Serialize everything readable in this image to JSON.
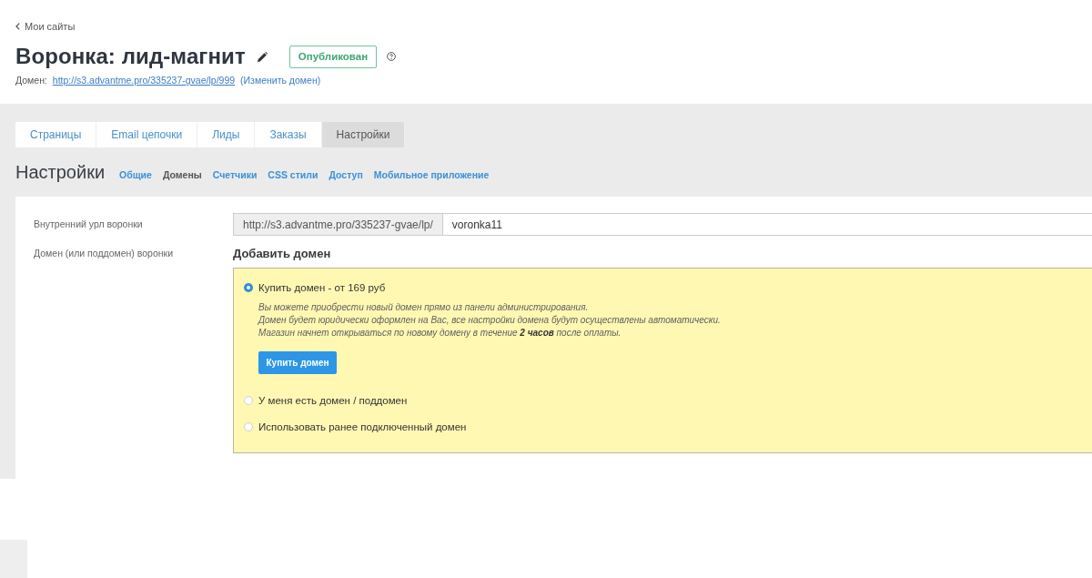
{
  "back_link": {
    "label": "Мои сайты"
  },
  "title": "Воронка: лид-магнит",
  "status_badge": "Опубликован",
  "domain_line": {
    "label": "Домен:",
    "url": "http://s3.advantme.pro/335237-gvae/lp/999",
    "change_link": "(Изменить домен)"
  },
  "tabs": [
    {
      "label": "Страницы",
      "selected": false
    },
    {
      "label": "Email цепочки",
      "selected": false
    },
    {
      "label": "Лиды",
      "selected": false
    },
    {
      "label": "Заказы",
      "selected": false
    },
    {
      "label": "Настройки",
      "selected": true
    }
  ],
  "section": {
    "title": "Настройки",
    "subnav": [
      {
        "label": "Общие",
        "selected": false
      },
      {
        "label": "Домены",
        "selected": true
      },
      {
        "label": "Счетчики",
        "selected": false
      },
      {
        "label": "CSS стили",
        "selected": false
      },
      {
        "label": "Доступ",
        "selected": false
      },
      {
        "label": "Мобильное приложение",
        "selected": false
      }
    ]
  },
  "form": {
    "url_row": {
      "label": "Внутренний урл воронки",
      "prefix": "http://s3.advantme.pro/335237-gvae/lp/",
      "value": "voronka11"
    },
    "domain_row": {
      "label": "Домен (или поддомен) воронки",
      "heading": "Добавить домен",
      "options": [
        {
          "label": "Купить домен - от 169 руб",
          "selected": true,
          "description": [
            "Вы можете приобрести новый домен прямо из панели администрирования.",
            "Домен будет юридически оформлен на Вас, все настройки домена будут осуществлены автоматически.",
            "Магазин начнет открываться по новому домену в течение **2 часов** после оплаты."
          ],
          "button": "Купить домен"
        },
        {
          "label": "У меня есть домен / поддомен",
          "selected": false
        },
        {
          "label": "Использовать ранее подключенный домен",
          "selected": false
        }
      ]
    }
  }
}
